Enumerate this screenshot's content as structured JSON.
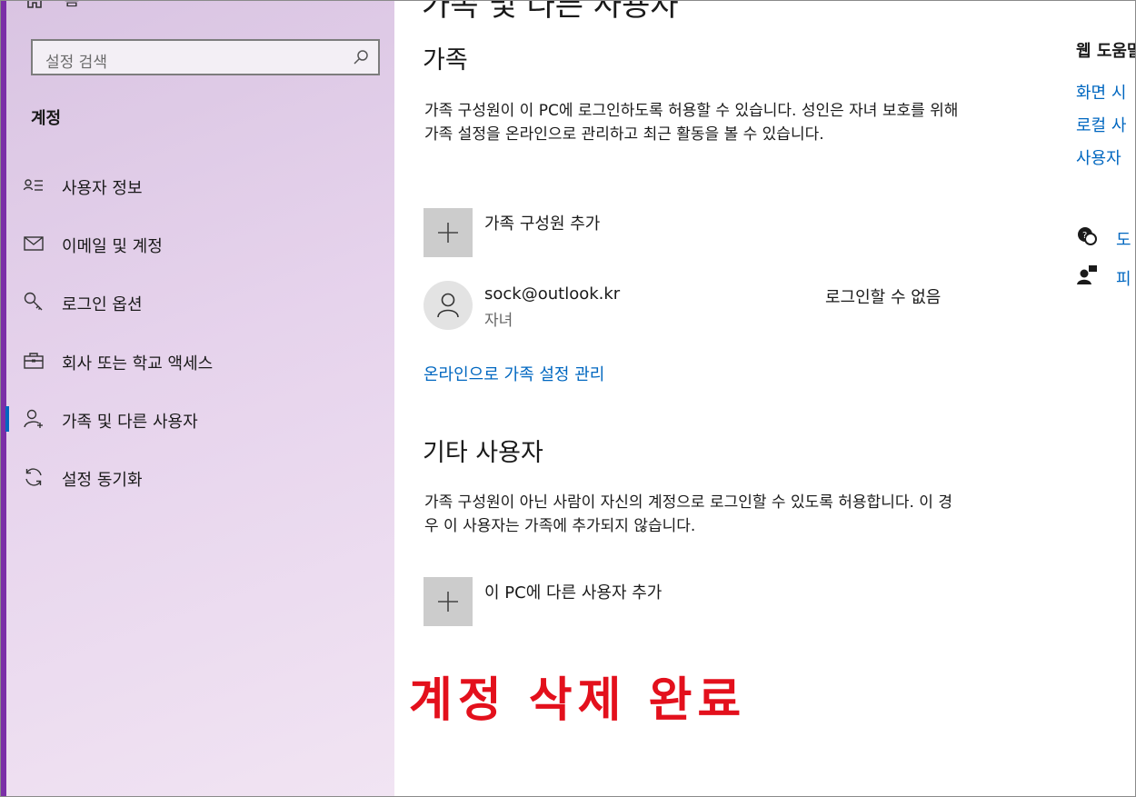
{
  "window": {
    "home_label": "홈",
    "accent_color": "#7b2fa7"
  },
  "sidebar": {
    "search_placeholder": "설정 검색",
    "section_title": "계정",
    "items": [
      {
        "label": "사용자 정보",
        "icon": "user-info-icon"
      },
      {
        "label": "이메일 및 계정",
        "icon": "mail-icon"
      },
      {
        "label": "로그인 옵션",
        "icon": "key-icon"
      },
      {
        "label": "회사 또는 학교 액세스",
        "icon": "briefcase-icon"
      },
      {
        "label": "가족 및 다른 사용자",
        "icon": "person-add-icon",
        "active": true
      },
      {
        "label": "설정 동기화",
        "icon": "sync-icon"
      }
    ]
  },
  "main": {
    "page_title": "가족 및 다른 사용자",
    "family": {
      "heading": "가족",
      "description": "가족 구성원이 이 PC에 로그인하도록 허용할 수 있습니다. 성인은 자녀 보호를 위해 가족 설정을 온라인으로 관리하고 최근 활동을 볼 수 있습니다.",
      "add_label": "가족 구성원 추가",
      "member": {
        "email": "sock@outlook.kr",
        "role": "자녀",
        "status": "로그인할 수 없음"
      },
      "manage_link": "온라인으로 가족 설정 관리"
    },
    "others": {
      "heading": "기타 사용자",
      "description": "가족 구성원이 아닌 사람이 자신의 계정으로 로그인할 수 있도록 허용합니다. 이 경우 이 사용자는 가족에 추가되지 않습니다.",
      "add_label": "이 PC에 다른 사용자 추가"
    },
    "banner": "계정 삭제 완료"
  },
  "right_panel": {
    "title": "웹 도움말",
    "links": [
      "화면 시",
      "로컬 사",
      "사용자"
    ],
    "help_link": "도",
    "feedback_link": "피"
  },
  "colors": {
    "link": "#0067c0",
    "banner": "#e3101c",
    "tile": "#cccccc"
  }
}
